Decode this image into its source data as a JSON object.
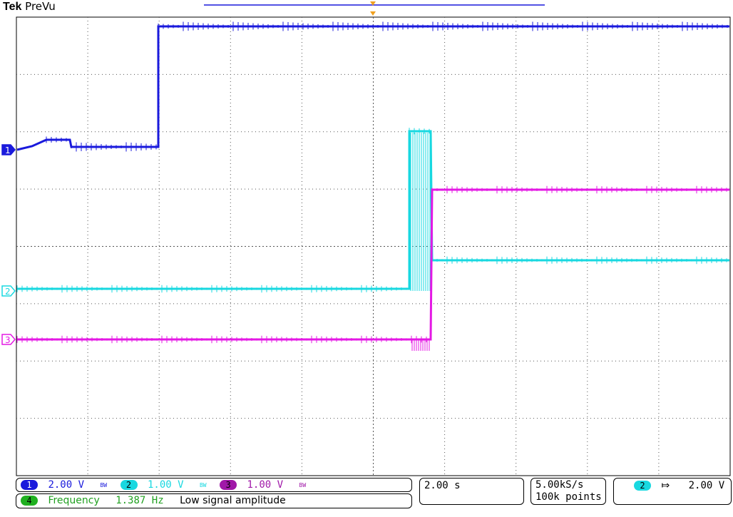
{
  "header": {
    "brand": "Tek",
    "mode": "PreVu"
  },
  "colors": {
    "ch1": "#1a1adc",
    "ch2": "#18d8e0",
    "ch3": "#e418e4",
    "ch4": "#20b020",
    "grid": "#555555",
    "trigger": "#f0a020"
  },
  "channel_markers": [
    {
      "label": "1",
      "color": "#1a1adc"
    },
    {
      "label": "2",
      "color": "#18d8e0"
    },
    {
      "label": "3",
      "color": "#e418e4"
    }
  ],
  "readout": {
    "ch1": {
      "label": "1",
      "scale": "2.00 V",
      "bw": "BW"
    },
    "ch2": {
      "label": "2",
      "scale": "1.00 V",
      "bw": "BW"
    },
    "ch3": {
      "label": "3",
      "scale": "1.00 V",
      "bw": "BW"
    },
    "measure": {
      "label": "4",
      "name": "Frequency",
      "value": "1.387 Hz",
      "note": "Low signal amplitude"
    }
  },
  "timebase": {
    "scale": "2.00 s"
  },
  "acquisition": {
    "rate": "5.00kS/s",
    "points": "100k points"
  },
  "trigger": {
    "source": "2",
    "slope_icon": "falling-edge-icon",
    "slope_glyph": "⤇",
    "level": "2.00 V"
  }
}
